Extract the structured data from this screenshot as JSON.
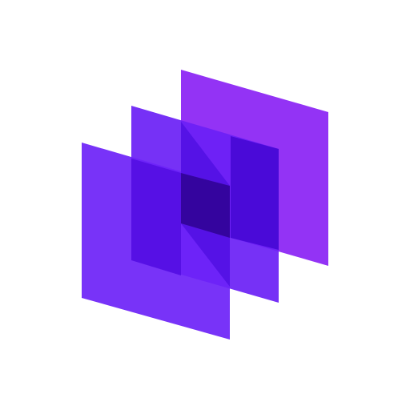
{
  "logo": {
    "icon_name": "stacked-layers-logo-icon",
    "colors": {
      "back_sheet": "#9333f5",
      "middle_sheet": "#6a1ff5",
      "front_sheet": "#6d22f7",
      "overlap_dark": "#4a0ad8",
      "overlap_deepest": "#34049e"
    }
  }
}
